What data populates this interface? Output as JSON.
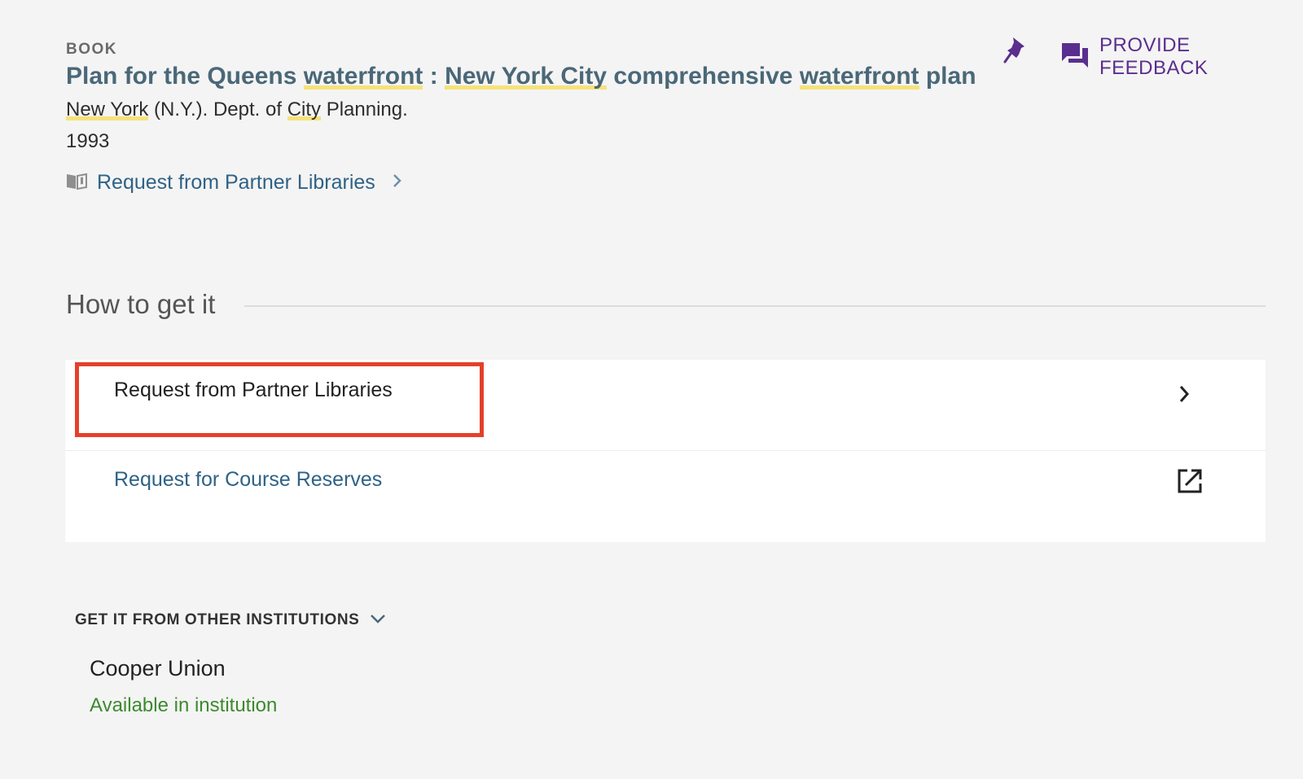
{
  "record": {
    "type": "BOOK",
    "title_parts": [
      "Plan for the Queens ",
      "waterfront",
      " : ",
      "New York City",
      " comprehensive ",
      "waterfront",
      " plan"
    ],
    "author_parts": [
      "New York",
      " (N.Y.). Dept. of ",
      "City",
      " Planning."
    ],
    "date": "1993",
    "quick_link": "Request from Partner Libraries"
  },
  "actions": {
    "feedback_label": "PROVIDE FEEDBACK"
  },
  "how_to_get": {
    "heading": "How to get it",
    "options": [
      {
        "label": "Request from Partner Libraries",
        "icon": "chevron-right-icon"
      },
      {
        "label": "Request for Course Reserves",
        "icon": "external-link-icon"
      }
    ]
  },
  "other_institutions": {
    "heading": "GET IT FROM OTHER INSTITUTIONS",
    "items": [
      {
        "name": "Cooper Union",
        "status": "Available in institution"
      }
    ]
  },
  "colors": {
    "title": "#4a6878",
    "link": "#2f6286",
    "feedback": "#5a2e8e",
    "highlight": "#f6e27a",
    "available": "#3c8a2e",
    "selection_box": "#e5402a"
  }
}
